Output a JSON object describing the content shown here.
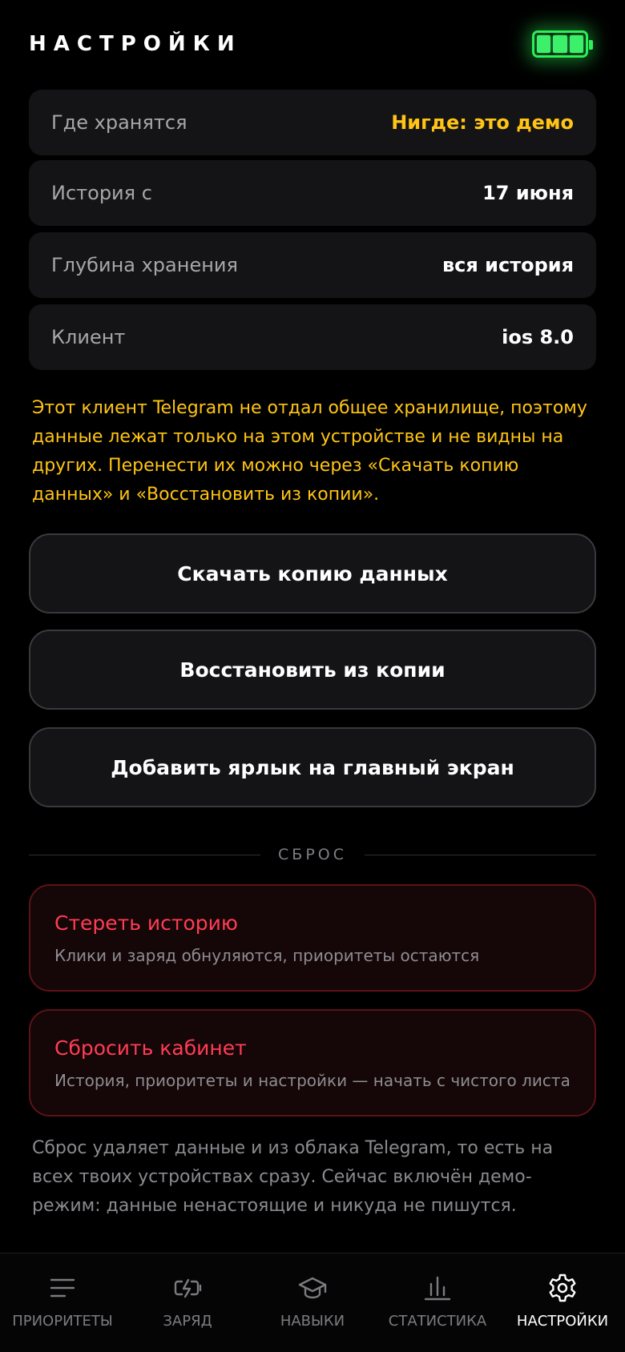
{
  "header": {
    "title": "НАСТРОЙКИ",
    "battery_icon": "battery-full-icon",
    "battery_color": "#2cf05a"
  },
  "info_rows": [
    {
      "label": "Где хранятся",
      "value": "Нигде: это демо"
    },
    {
      "label": "История с",
      "value": "17 июня"
    },
    {
      "label": "Глубина хранения",
      "value": "вся история"
    },
    {
      "label": "Клиент",
      "value": "ios 8.0"
    }
  ],
  "notice": "Этот клиент Telegram не отдал общее хранилище, поэтому данные лежат только на этом устройстве и не видны на других. Перенести их можно через «Скачать копию данных» и «Восстановить из копии».",
  "actions": {
    "download": "Скачать копию данных",
    "restore": "Восстановить из копии",
    "shortcut": "Добавить ярлык на главный экран"
  },
  "reset_section": {
    "label": "СБРОС",
    "erase": {
      "title": "Стереть историю",
      "subtitle": "Клики и заряд обнуляются, приоритеты остаются"
    },
    "reset": {
      "title": "Сбросить кабинет",
      "subtitle": "История, приоритеты и настройки — начать с чистого листа"
    }
  },
  "footnote": "Сброс удаляет данные и из облака Telegram, то есть на всех твоих устройствах сразу. Сейчас включён демо-режим: данные ненастоящие и никуда не пишутся.",
  "colors": {
    "accent": "#ffc414",
    "danger": "#ff3d55",
    "card": "#141416"
  },
  "tabs": [
    {
      "label": "ПРИОРИТЕТЫ",
      "icon": "list-lines-icon"
    },
    {
      "label": "ЗАРЯД",
      "icon": "battery-charge-icon"
    },
    {
      "label": "НАВЫКИ",
      "icon": "graduation-cap-icon"
    },
    {
      "label": "СТАТИСТИКА",
      "icon": "bar-chart-icon"
    },
    {
      "label": "НАСТРОЙКИ",
      "icon": "gear-icon",
      "active": true
    }
  ]
}
